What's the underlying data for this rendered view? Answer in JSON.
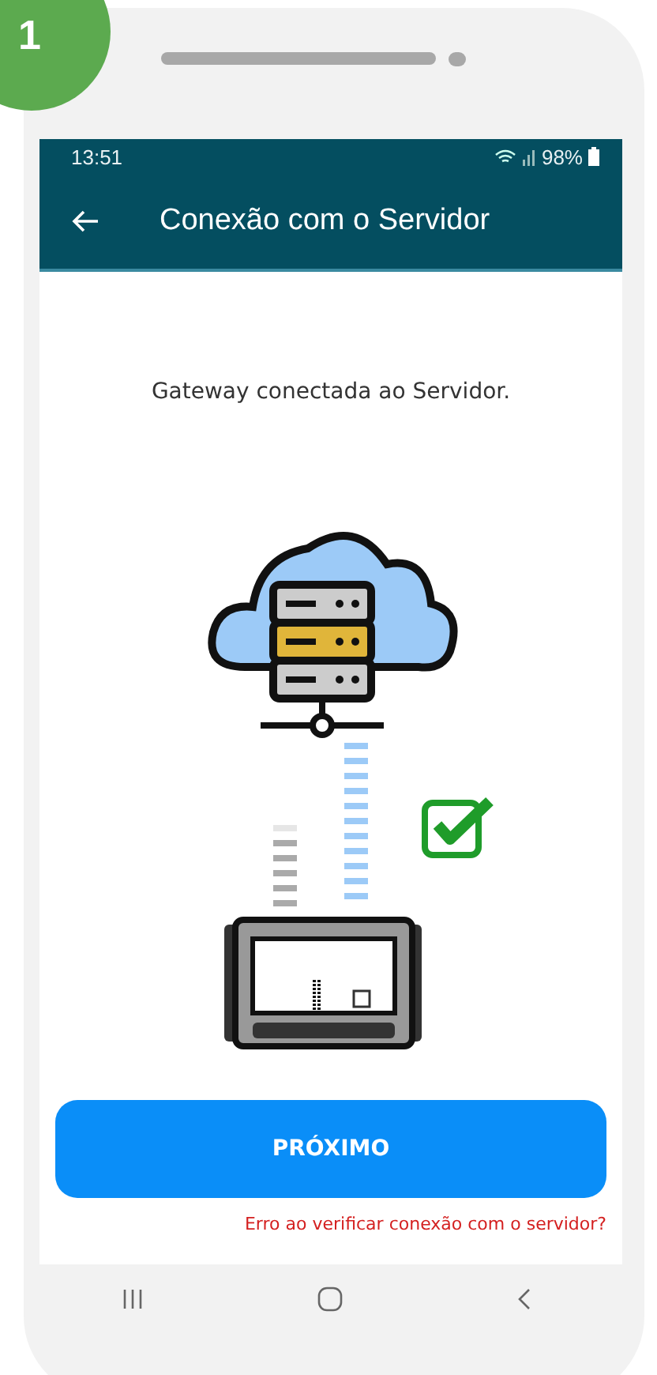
{
  "step_badge": "1",
  "status_bar": {
    "time": "13:51",
    "battery": "98%"
  },
  "app_bar": {
    "title": "Conexão com o Servidor"
  },
  "message": "Gateway conectada ao Servidor.",
  "connection": {
    "checked": true
  },
  "next_button": "PRÓXIMO",
  "error_link": "Erro ao verificar conexão com o servidor?"
}
